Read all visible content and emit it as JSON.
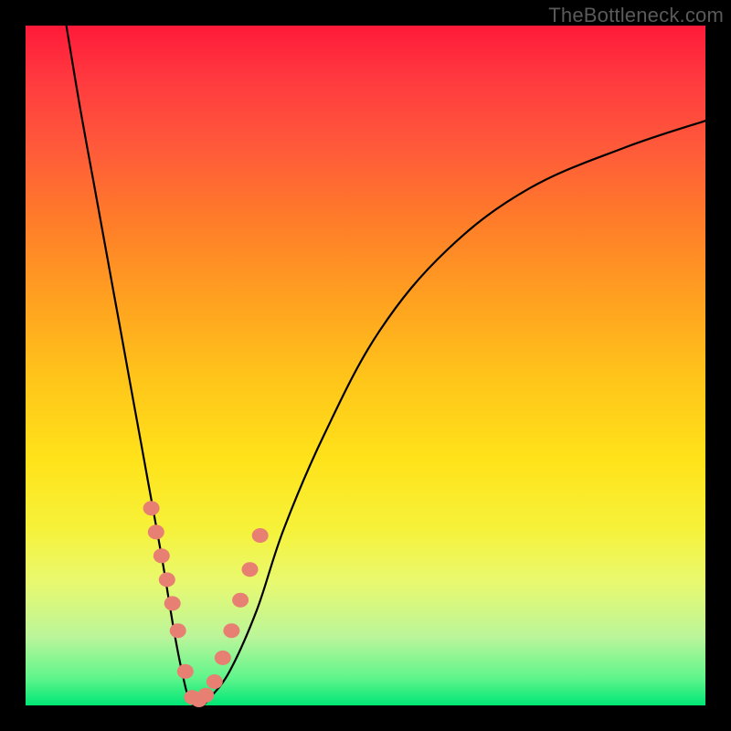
{
  "watermark": "TheBottleneck.com",
  "colors": {
    "frame": "#000000",
    "gradient_top": "#ff1a3a",
    "gradient_bottom": "#00e676",
    "curve": "#000000",
    "markers": "#e77f73"
  },
  "chart_data": {
    "type": "line",
    "title": "",
    "xlabel": "",
    "ylabel": "",
    "xlim": [
      0,
      100
    ],
    "ylim": [
      0,
      100
    ],
    "grid": false,
    "legend": false,
    "series": [
      {
        "name": "bottleneck-curve",
        "x": [
          6,
          8,
          10,
          12,
          14,
          16,
          18,
          20,
          21,
          22,
          23,
          24,
          25,
          26,
          27,
          30,
          34,
          38,
          44,
          52,
          62,
          74,
          88,
          100
        ],
        "y": [
          100,
          88,
          77,
          66,
          55,
          44,
          33,
          22,
          16,
          10,
          5,
          1,
          0,
          0,
          1,
          5,
          14,
          26,
          40,
          55,
          67,
          76,
          82,
          86
        ]
      }
    ],
    "markers": {
      "name": "highlighted-points",
      "x": [
        18.5,
        19.2,
        20.0,
        20.8,
        21.6,
        22.4,
        23.5,
        24.5,
        25.5,
        26.5,
        27.8,
        29.0,
        30.3,
        31.6,
        33.0,
        34.5
      ],
      "y": [
        29.0,
        25.5,
        22.0,
        18.5,
        15.0,
        11.0,
        5.0,
        1.2,
        0.8,
        1.5,
        3.5,
        7.0,
        11.0,
        15.5,
        20.0,
        25.0
      ]
    }
  }
}
